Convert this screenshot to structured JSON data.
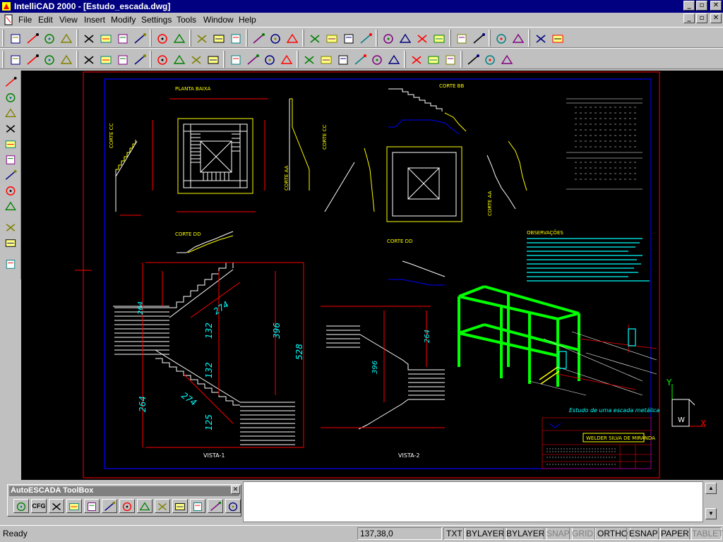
{
  "app": {
    "title": "IntelliCAD 2000 - [Estudo_escada.dwg]",
    "window_buttons": [
      "_",
      "▫",
      "✕"
    ],
    "doc_buttons": [
      "_",
      "▫",
      "✕"
    ]
  },
  "menu": {
    "items": [
      {
        "id": "file",
        "label": "File"
      },
      {
        "id": "edit",
        "label": "Edit"
      },
      {
        "id": "view",
        "label": "View"
      },
      {
        "id": "insert",
        "label": "Insert"
      },
      {
        "id": "modify",
        "label": "Modify"
      },
      {
        "id": "settings",
        "label": "Settings"
      },
      {
        "id": "tools",
        "label": "Tools"
      },
      {
        "id": "window",
        "label": "Window"
      },
      {
        "id": "help",
        "label": "Help"
      }
    ]
  },
  "drawing": {
    "colors": {
      "bg": "#000000",
      "frame": "#ff0000",
      "border": "#0000ff",
      "geometry": "#ffffff",
      "dims": "#ff0000",
      "text": "#ffff00",
      "cyan": "#00ffff",
      "green": "#00ff00"
    },
    "labels": {
      "planta_baixa": "PLANTA BAIXA",
      "corte_cc": "CORTE CC",
      "corte_aa": "CORTE AA",
      "corte_bb": "CORTE BB",
      "corte_dd": "CORTE DD",
      "corte_cc2": "CORTE CC",
      "corte_aa2": "CORTE AA",
      "corte_dd2": "CORTE DD",
      "vista1": "VISTA-1",
      "vista2": "VISTA-2",
      "observacoes": "OBSERVAÇÕES",
      "estudo": "Estudo de uma escada metálica",
      "autor": "WELDER SILVA DE MIRANDA",
      "dims": {
        "d274a": "274",
        "d132": "132",
        "d396": "396",
        "d528": "528",
        "d264a": "264",
        "d274b": "274",
        "d132b": "132",
        "d125": "125",
        "d264b": "264",
        "d264c": "264",
        "d396b": "396"
      }
    }
  },
  "commandline": {
    "toolbox_title": "AutoESCADA ToolBox",
    "close_label": "✕",
    "cfg_label": "CFG",
    "scroll_up": "▲",
    "scroll_down": "▼"
  },
  "status": {
    "ready": "Ready",
    "coords": "137,38,0",
    "panels": [
      {
        "label": "TXT",
        "active": true
      },
      {
        "label": "BYLAYER",
        "active": true
      },
      {
        "label": "BYLAYER",
        "active": true
      },
      {
        "label": "SNAP",
        "active": false
      },
      {
        "label": "GRID",
        "active": false
      },
      {
        "label": "ORTHO",
        "active": true
      },
      {
        "label": "ESNAP",
        "active": true
      },
      {
        "label": "PAPER",
        "active": true
      },
      {
        "label": "TABLET",
        "active": false
      }
    ]
  },
  "icons": {
    "toolbar1": [
      "new-icon",
      "open-icon",
      "save-icon",
      "print-icon",
      "cut-icon",
      "copy-icon",
      "paste-icon",
      "matchprop-icon",
      "undo-icon",
      "redo-icon",
      "delete-icon",
      "cancel-icon",
      "help-icon",
      "layer-icon",
      "copy-obj-icon",
      "mirror-icon",
      "rotate-icon",
      "array-icon",
      "scale-icon",
      "trim-icon",
      "extend-icon",
      "break-icon",
      "fillet-icon",
      "chamfer-icon",
      "explode-icon",
      "properties-icon",
      "text-style-icon",
      "pencil-icon",
      "window-icon",
      "tile-icon"
    ],
    "toolbar2": [
      "line-icon",
      "polyline-icon",
      "arc-icon",
      "spline-icon",
      "circle-icon",
      "ellipse-icon",
      "donut-icon",
      "point-icon",
      "rectangle-icon",
      "polygon-icon",
      "ring-icon",
      "solid-icon",
      "hatch-icon",
      "text-icon",
      "mtext-icon",
      "dimension-icon",
      "pan-icon",
      "zoom-in-icon",
      "zoom-out-icon",
      "zoom-window-icon",
      "zoom-all-icon",
      "zoom-prev-icon",
      "redraw-icon",
      "regen-icon",
      "layer-state-icon",
      "color-icon",
      "table-icon",
      "document-icon"
    ],
    "left": [
      "circle-tool-icon",
      "line-tool-icon",
      "xline-tool-icon",
      "target-tool-icon",
      "node-tool-icon",
      "quadrant-tool-icon",
      "center-tool-icon",
      "square-tool-icon",
      "crosshair-tool-icon",
      "intersect-tool-icon",
      "perpendicular-tool-icon",
      "nearest-tool-icon"
    ]
  }
}
